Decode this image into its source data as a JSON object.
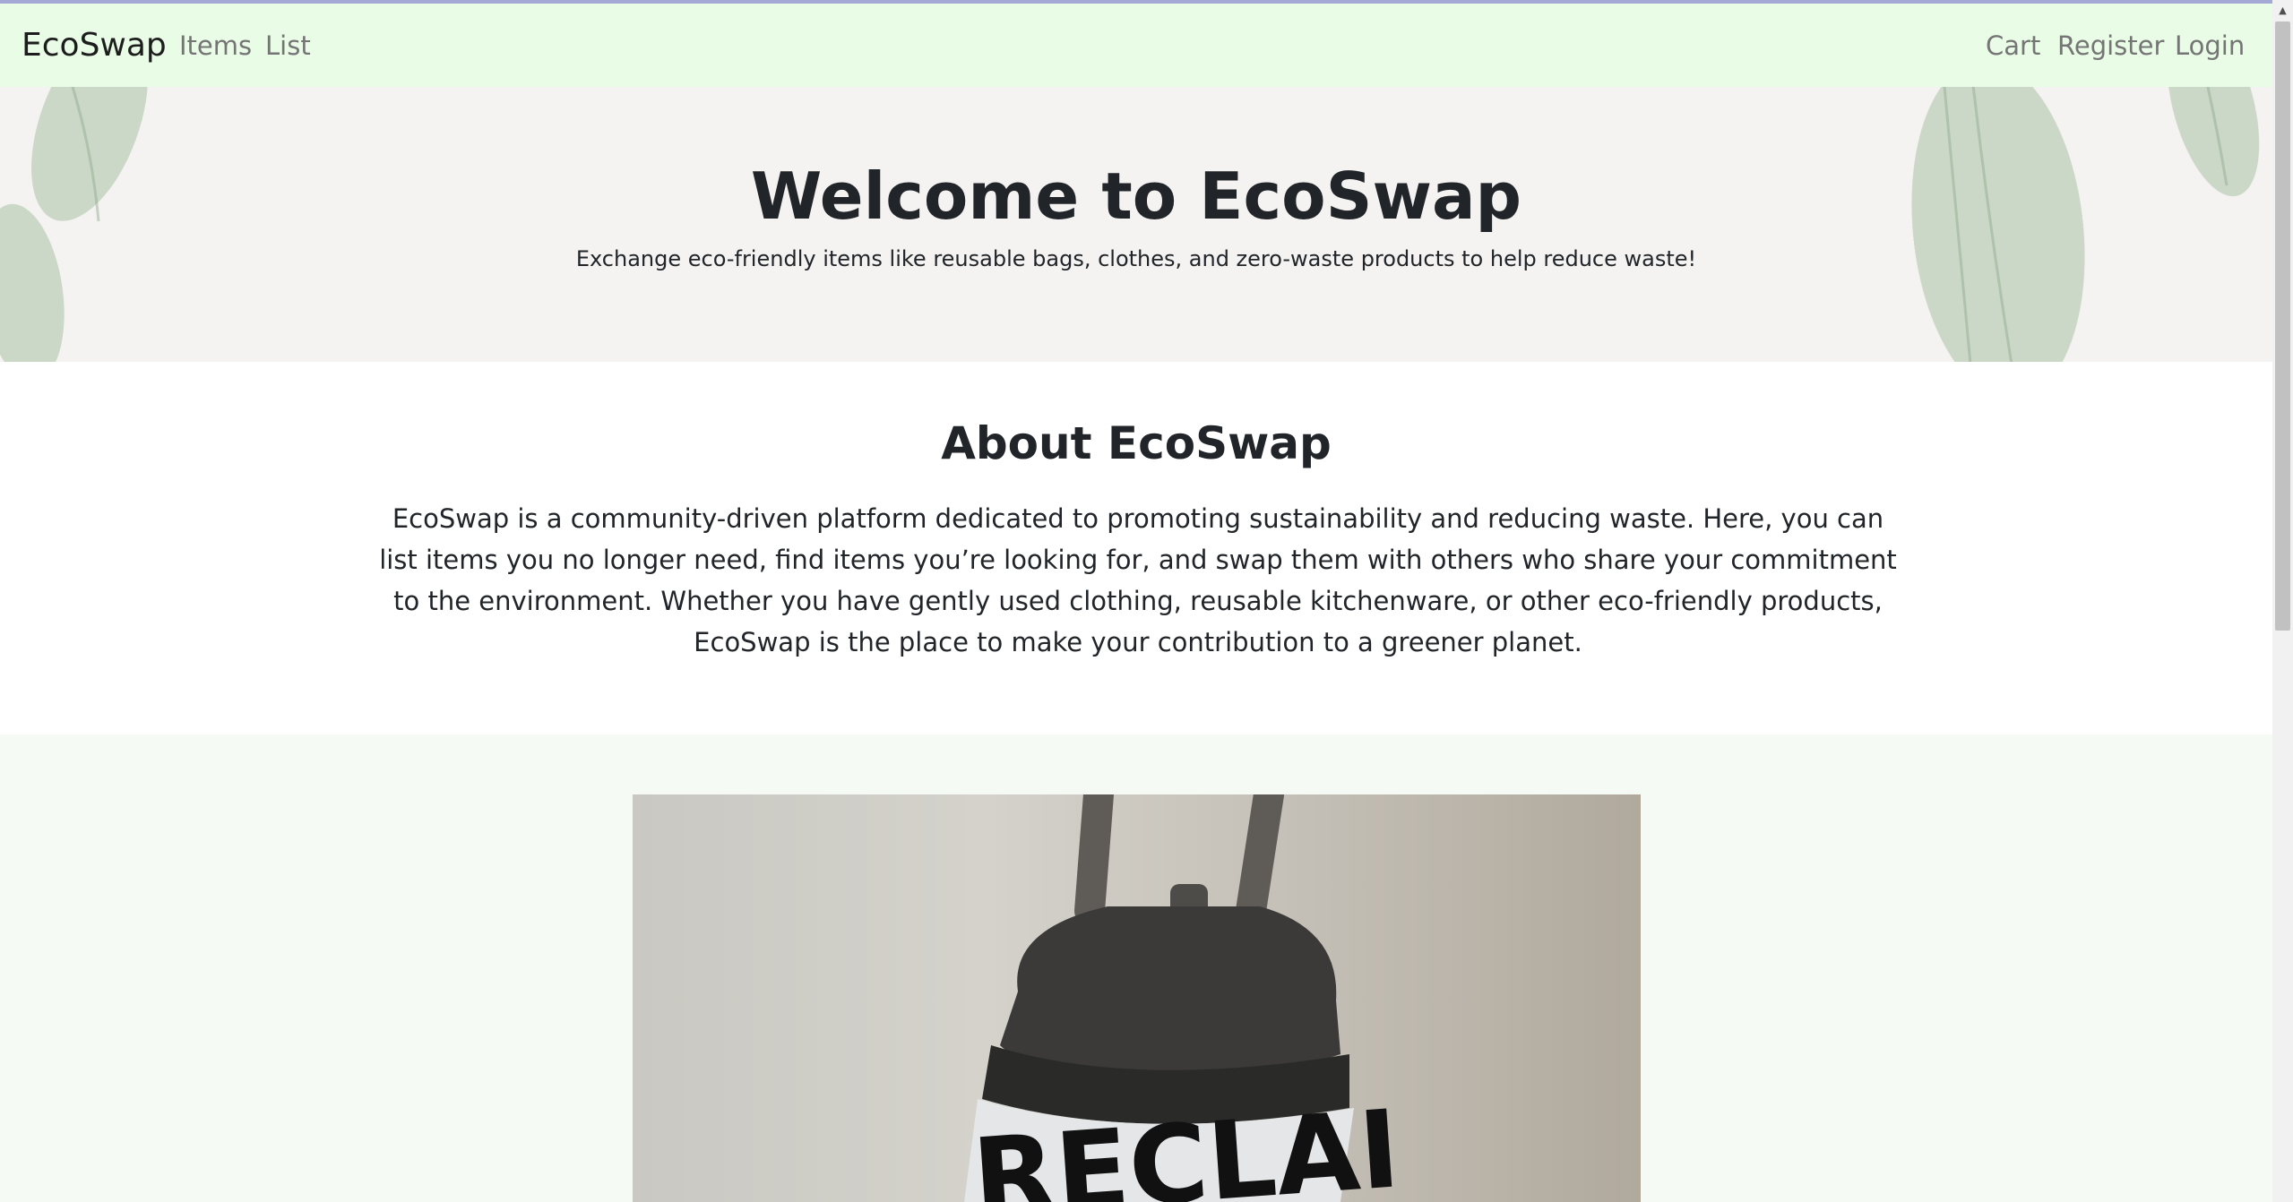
{
  "nav": {
    "brand": "EcoSwap",
    "left_links": [
      "Items",
      "List"
    ],
    "right_links": [
      "Cart",
      "Register",
      "Login"
    ]
  },
  "hero": {
    "title": "Welcome to EcoSwap",
    "subtitle": "Exchange eco-friendly items like reusable bags, clothes, and zero-waste products to help reduce waste!"
  },
  "about": {
    "title": "About EcoSwap",
    "text": "EcoSwap is a community-driven platform dedicated to promoting sustainability and reducing waste. Here, you can list items you no longer need, find items you’re looking for, and swap them with others who share your commitment to the environment. Whether you have gently used clothing, reusable kitchenware, or other eco-friendly products, EcoSwap is the place to make your contribution to a greener planet."
  },
  "item_photo": {
    "visible_text": "RECLAI"
  },
  "colors": {
    "navbar_bg": "#e9fce6",
    "hero_bg": "#f4f3f1",
    "items_bg": "#f6faf4",
    "leaf_green": "#a9c0a4"
  }
}
